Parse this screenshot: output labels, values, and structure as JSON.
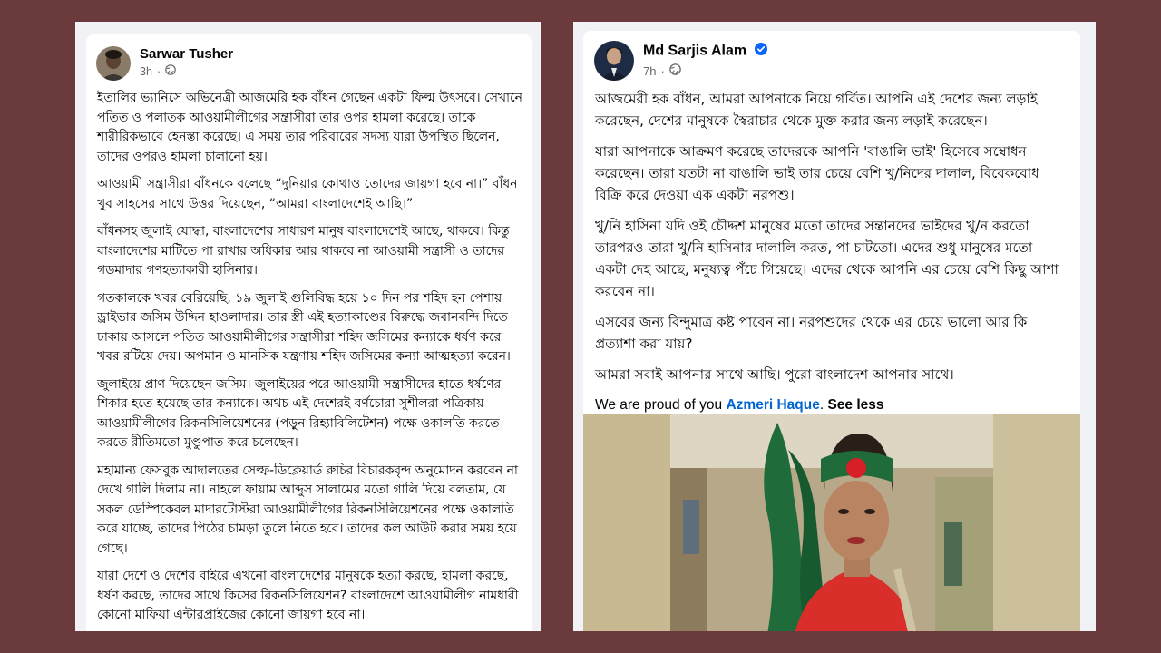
{
  "left_post": {
    "author": "Sarwar Tusher",
    "time": "3h",
    "separator": "·",
    "globe_icon": "globe-icon",
    "paragraphs": [
      "ইতালির ভ্যানিসে অভিনেত্রী আজমেরি হক বাঁধন গেছেন একটা ফিল্ম উৎসবে। সেখানে পতিত ও পলাতক আওয়ামীলীগের সন্ত্রাসীরা তার ওপর হামলা করেছে। তাকে শারীরিকভাবে হেনস্তা করেছে। এ সময় তার পরিবারের সদস্য যারা উপস্থিত ছিলেন, তাদের ওপরও হামলা চালানো হয়।",
      "আওয়ামী সন্ত্রাসীরা বাঁধনকে বলেছে “দুনিয়ার কোথাও তোদের জায়গা হবে না।” বাঁধন খুব সাহসের সাথে উত্তর দিয়েছেন, “আমরা বাংলাদেশেই আছি।”",
      "বাঁধনসহ জুলাই যোদ্ধা, বাংলাদেশের সাধারণ মানুষ বাংলাদেশেই আছে, থাকবে। কিন্তু বাংলাদেশের মাটিতে পা রাখার অধিকার আর থাকবে না আওয়ামী সন্ত্রাসী ও তাদের গডমাদার গণহত্যাকারী হাসিনার।",
      "গতকালকে খবর বেরিয়েছি, ১৯ জুলাই গুলিবিদ্ধ হয়ে ১০ দিন পর শহিদ হন পেশায় ড্রাইভার জসিম উদ্দিন হাওলাদার। তার স্ত্রী এই হত্যাকাণ্ডের বিরুদ্ধে জবানবন্দি দিতে ঢাকায় আসলে পতিত আওয়ামীলীগের সন্ত্রাসীরা শহিদ জসিমের কন্যাকে ধর্ষণ করে খবর রটিয়ে দেয়। অপমান ও মানসিক যন্ত্রণায় শহিদ জসিমের কন্যা আত্মহত্যা করেন।",
      "জুলাইয়ে প্রাণ দিয়েছেন জসিম। জুলাইয়ের পরে আওয়ামী সন্ত্রাসীদের হাতে ধর্ষণের শিকার হতে হয়েছে তার কন্যাকে। অথচ এই দেশেরই বর্ণচোরা সুশীলরা পত্রিকায় আওয়ামীলীগের রিকনসিলিয়েশনের (পড়ুন রিহ্যাবিলিটেশন) পক্ষে ওকালতি করতে করতে রীতিমতো মুণ্ডুপাত করে চলেছেন।",
      "মহামান্য ফেসবুক আদালতের সেল্ফ-ডিক্লেয়ার্ড রুচির বিচারকবৃন্দ অনুমোদন করবেন না দেখে গালি দিলাম না। নাহলে ফায়াম আব্দুস সালামের মতো গালি দিয়ে বলতাম, যে সকল ডেস্পিকেবল মাদারটোস্টরা আওয়ামীলীগের রিকনসিলিয়েশনের পক্ষে ওকালতি করে যাচ্ছে, তাদের পিঠের চামড়া তুলে নিতে হবে। তাদের কল আউট করার সময় হয়ে গেছে।",
      "যারা দেশে ও দেশের বাইরে এখনো বাংলাদেশের মানুষকে হত্যা করছে, হামলা করছে, ধর্ষণ করছে, তাদের সাথে কিসের রিকনসিলিয়েশন? বাংলাদেশে আওয়ামীলীগ নামধারী কোনো মাফিয়া এন্টারপ্রাইজের কোনো জায়গা হবে না।"
    ]
  },
  "right_post": {
    "author": "Md Sarjis Alam",
    "verified_icon": "verified-badge-icon",
    "time": "7h",
    "separator": "·",
    "globe_icon": "globe-icon",
    "paragraphs": [
      "আজমেরী হক বাঁধন, আমরা আপনাকে নিয়ে গর্বিত। আপনি এই দেশের জন্য লড়াই করেছেন, দেশের মানুষকে স্বৈরাচার থেকে মুক্ত করার জন্য লড়াই করেছেন।",
      "যারা আপনাকে আক্রমণ করেছে তাদেরকে আপনি 'বাঙালি ভাই' হিসেবে সম্বোধন করেছেন। তারা যতটা না বাঙালি ভাই তার চেয়ে বেশি খু/নিদের দালাল, বিবেকবোধ বিক্রি করে দেওয়া এক একটা নরপশু।",
      "খু/নি হাসিনা যদি ওই চৌদ্দশ মানুষের মতো তাদের সন্তানদের ভাইদের খু/ন করতো  তারপরও তারা খু/নি হাসিনার দালালি করত, পা চাটতো। এদের শুধু মানুষের মতো একটা দেহ আছে, মনুষ্যত্ব পঁচে গিয়েছে। এদের থেকে আপনি এর চেয়ে বেশি কিছু আশা করবেন না।",
      "এসবের জন্য বিন্দুমাত্র কষ্ট পাবেন না। নরপশুদের থেকে এর চেয়ে ভালো আর কি প্রত্যাশা করা যায়?",
      "আমরা সবাই আপনার সাথে আছি। পুরো বাংলাদেশ আপনার সাথে।"
    ],
    "english_prefix": "We are proud of you ",
    "mention": "Azmeri Haque",
    "english_suffix": ".",
    "see_less": "See less",
    "photo_icon": "woman-with-flag-photo"
  },
  "colors": {
    "background": "#6b3a3c",
    "mention": "#0064d1",
    "verified": "#0866ff",
    "flag_green": "#1f6b3a",
    "flag_red": "#d61f26"
  }
}
